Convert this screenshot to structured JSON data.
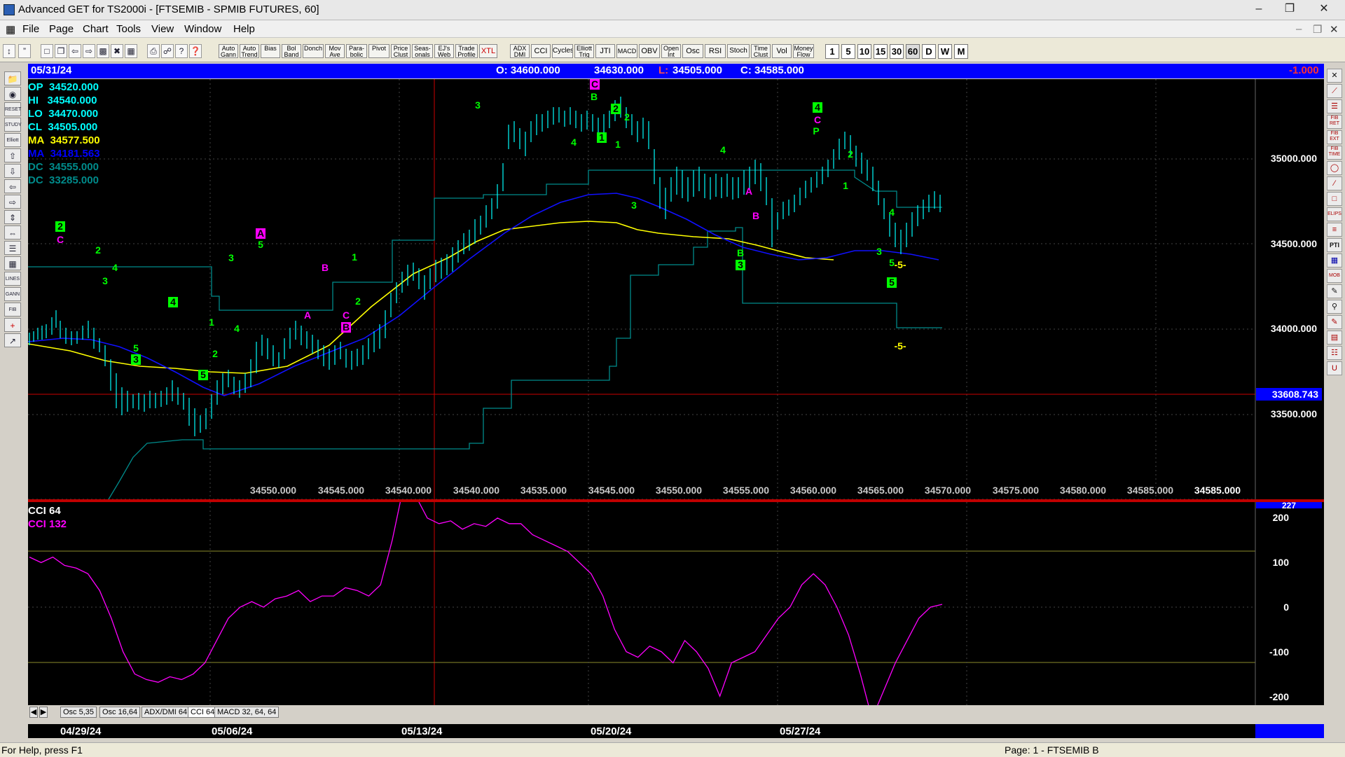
{
  "window": {
    "title": "Advanced GET for TS2000i - [FTSEMIB - SPMIB FUTURES, 60]"
  },
  "menu": [
    "File",
    "Page",
    "Chart",
    "Tools",
    "View",
    "Window",
    "Help"
  ],
  "toolbar": {
    "study_buttons": [
      "Auto Gann",
      "Auto Trend",
      "Bias",
      "Bol Band",
      "Donch",
      "Mov Ave",
      "Para-bolic",
      "Pivot",
      "Price Clust",
      "Seas-onals",
      "EJ's Web",
      "Trade Profile",
      "XTL",
      "ADX DMI",
      "CCI",
      "Cycles",
      "Elliott Trig",
      "JTI",
      "MACD",
      "OBV",
      "Open Int",
      "Osc",
      "RSI",
      "Stoch",
      "Time Clust",
      "Vol",
      "Money Flow"
    ],
    "periods": [
      "1",
      "5",
      "10",
      "15",
      "30",
      "60",
      "D",
      "W",
      "M"
    ]
  },
  "info_bar": {
    "date": "05/31/24",
    "open": "O: 34600.000",
    "high": "34630.000",
    "low_label": "L:",
    "low": "34505.000",
    "close": "C: 34585.000",
    "change": "-1.000"
  },
  "legend": [
    {
      "label": "OP",
      "value": "34520.000",
      "color": "#00ffff"
    },
    {
      "label": "HI",
      "value": "34540.000",
      "color": "#00ffff"
    },
    {
      "label": "LO",
      "value": "34470.000",
      "color": "#00ffff"
    },
    {
      "label": "CL",
      "value": "34505.000",
      "color": "#00ffff"
    },
    {
      "label": "MA",
      "value": "34577.500",
      "color": "#ffff00"
    },
    {
      "label": "MA",
      "value": "34181.563",
      "color": "#0000ff"
    },
    {
      "label": "DC",
      "value": "34555.000",
      "color": "#008b8b"
    },
    {
      "label": "DC",
      "value": "33285.000",
      "color": "#008b8b"
    }
  ],
  "price_axis": [
    "35000.000",
    "34500.000",
    "34000.000",
    "33500.000"
  ],
  "current_price_label": "33608.743",
  "bottom_price_labels": [
    "34550.000",
    "34545.000",
    "34540.000",
    "34540.000",
    "34535.000",
    "34545.000",
    "34550.000",
    "34555.000",
    "34560.000",
    "34565.000",
    "34570.000",
    "34575.000",
    "34580.000",
    "34585.000",
    "34585.000"
  ],
  "elliott_labels": [
    {
      "t": "2",
      "box": true,
      "c": "#00ff00"
    },
    {
      "t": "C",
      "c": "#ff00ff"
    },
    {
      "t": "2",
      "c": "#00ff00"
    },
    {
      "t": "4",
      "c": "#00ff00"
    },
    {
      "t": "3",
      "c": "#00ff00"
    },
    {
      "t": "5",
      "c": "#00ff00"
    },
    {
      "t": "3",
      "box": true,
      "c": "#00ff00"
    },
    {
      "t": "4",
      "box": true,
      "c": "#00ff00"
    },
    {
      "t": "1",
      "c": "#00ff00"
    },
    {
      "t": "2",
      "c": "#00ff00"
    },
    {
      "t": "5",
      "box": true,
      "c": "#00ff00"
    },
    {
      "t": "3",
      "c": "#00ff00"
    },
    {
      "t": "4",
      "c": "#00ff00"
    },
    {
      "t": "A",
      "box": true,
      "c": "#ff00ff"
    },
    {
      "t": "5",
      "c": "#00ff00"
    },
    {
      "t": "B",
      "c": "#ff00ff"
    },
    {
      "t": "A",
      "c": "#ff00ff"
    },
    {
      "t": "1",
      "c": "#00ff00"
    },
    {
      "t": "2",
      "c": "#00ff00"
    },
    {
      "t": "C",
      "c": "#ff00ff"
    },
    {
      "t": "B",
      "box": true,
      "c": "#ff00ff"
    },
    {
      "t": "3",
      "c": "#00ff00"
    },
    {
      "t": "4",
      "c": "#00ff00"
    },
    {
      "t": "C",
      "box": true,
      "c": "#ff00ff"
    },
    {
      "t": "B",
      "c": "#00ff00"
    },
    {
      "t": "2",
      "box": true,
      "c": "#00ff00"
    },
    {
      "t": "2",
      "c": "#00ff00"
    },
    {
      "t": "1",
      "box": true,
      "c": "#00ff00"
    },
    {
      "t": "1",
      "c": "#00ff00"
    },
    {
      "t": "3",
      "c": "#00ff00"
    },
    {
      "t": "4",
      "c": "#00ff00"
    },
    {
      "t": "A",
      "c": "#ff00ff"
    },
    {
      "t": "B",
      "c": "#ff00ff"
    },
    {
      "t": "B",
      "c": "#00ff00"
    },
    {
      "t": "3",
      "box": true,
      "c": "#00ff00"
    },
    {
      "t": "4",
      "box": true,
      "c": "#00ff00"
    },
    {
      "t": "C",
      "c": "#ff00ff"
    },
    {
      "t": "P",
      "c": "#00ff00"
    },
    {
      "t": "2",
      "c": "#00ff00"
    },
    {
      "t": "1",
      "c": "#00ff00"
    },
    {
      "t": "4",
      "c": "#00ff00"
    },
    {
      "t": "3",
      "c": "#00ff00"
    },
    {
      "t": "5",
      "c": "#00ff00"
    },
    {
      "t": "-5-",
      "c": "#ffff00"
    },
    {
      "t": "5",
      "box": true,
      "c": "#00ff00"
    },
    {
      "t": "-5-",
      "c": "#ffff00"
    }
  ],
  "indicator": {
    "legend": [
      {
        "label": "CCI 64",
        "color": "#ffffff"
      },
      {
        "label": "CCI 132",
        "color": "#ff00ff"
      }
    ],
    "axis": [
      "200",
      "100",
      "0",
      "-100",
      "-200"
    ],
    "top_label": "227",
    "chart_data": {
      "type": "line",
      "title": "",
      "series": [
        {
          "name": "CCI 132",
          "values": [
            90,
            80,
            90,
            75,
            70,
            60,
            30,
            -20,
            -80,
            -120,
            -130,
            -135,
            -125,
            -130,
            -120,
            -100,
            -60,
            -20,
            0,
            10,
            0,
            15,
            20,
            30,
            10,
            20,
            20,
            35,
            30,
            20,
            40,
            120,
            220,
            200,
            160,
            150,
            155,
            140,
            150,
            145,
            160,
            150,
            150,
            130,
            120,
            110,
            100,
            80,
            60,
            20,
            -40,
            -80,
            -90,
            -70,
            -80,
            -100,
            -60,
            -80,
            -110,
            -160,
            -100,
            -90,
            -80,
            -50,
            -20,
            0,
            40,
            60,
            40,
            0,
            -50,
            -120,
            -200,
            -150,
            -100,
            -60,
            -20,
            0,
            5
          ]
        }
      ],
      "ylim": [
        -200,
        227
      ]
    }
  },
  "oscillator_tabs": [
    "Osc 5,35",
    "Osc 16,64",
    "ADX/DMI 64",
    "CCI 64",
    "MACD 32, 64, 64"
  ],
  "date_axis": [
    "04/29/24",
    "05/06/24",
    "05/13/24",
    "05/20/24",
    "05/27/24"
  ],
  "status": {
    "help": "For Help, press F1",
    "page": "Page: 1 - FTSEMIB B"
  }
}
